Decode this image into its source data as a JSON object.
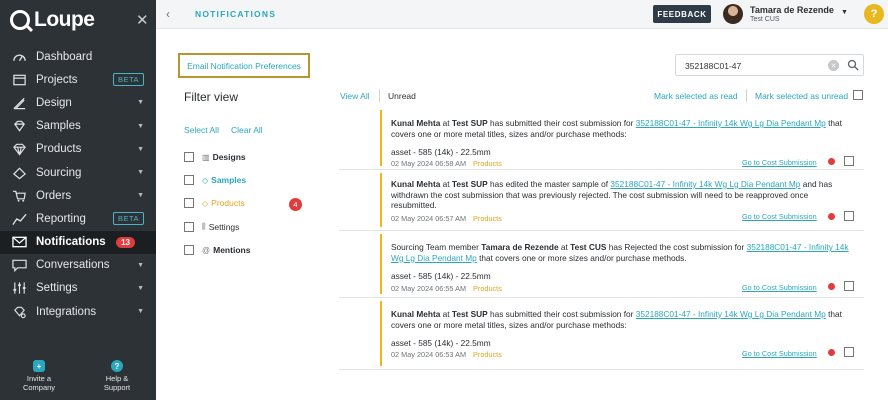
{
  "sidebar": {
    "logo": "Loupe",
    "items": [
      {
        "label": "Dashboard",
        "icon": "dashboard-icon"
      },
      {
        "label": "Projects",
        "icon": "projects-icon",
        "badge": "BETA"
      },
      {
        "label": "Design",
        "icon": "design-icon",
        "caret": "▼"
      },
      {
        "label": "Samples",
        "icon": "samples-icon",
        "caret": "▼"
      },
      {
        "label": "Products",
        "icon": "products-icon",
        "caret": "▼"
      },
      {
        "label": "Sourcing",
        "icon": "sourcing-icon",
        "caret": "▼"
      },
      {
        "label": "Orders",
        "icon": "orders-icon",
        "caret": "▼"
      },
      {
        "label": "Reporting",
        "icon": "reporting-icon",
        "badge": "BETA"
      },
      {
        "label": "Notifications",
        "icon": "mail-icon",
        "count": "13",
        "active": true
      },
      {
        "label": "Conversations",
        "icon": "chat-icon",
        "caret": "▼"
      },
      {
        "label": "Settings",
        "icon": "sliders-icon",
        "caret": "▼"
      },
      {
        "label": "Integrations",
        "icon": "integrations-icon",
        "caret": "▼"
      }
    ],
    "invite_label": "Invite a Company",
    "help_label": "Help & Support"
  },
  "topbar": {
    "breadcrumb": "NOTIFICATIONS",
    "feedback_label": "FEEDBACK",
    "user_name": "Tamara de Rezende",
    "user_org": "Test CUS",
    "help_glyph": "?"
  },
  "main": {
    "email_pref_label": "Email Notification Preferences",
    "search_value": "352188C01-47",
    "filter_title": "Filter view",
    "select_all": "Select All",
    "clear_all": "Clear All",
    "filters": [
      {
        "label": "Designs",
        "color": "#2b2f33",
        "bold": true
      },
      {
        "label": "Samples",
        "color": "#29a8bd",
        "bold": true
      },
      {
        "label": "Products",
        "color": "#e8a21c",
        "bold": false,
        "count": "4"
      },
      {
        "label": "Settings",
        "color": "#2b2f33",
        "bold": false
      },
      {
        "label": "Mentions",
        "color": "#2b2f33",
        "bold": true
      }
    ],
    "tab_view_all": "View All",
    "tab_unread": "Unread",
    "mark_read": "Mark selected as read",
    "mark_unread": "Mark selected as unread"
  },
  "notifications": [
    {
      "actor": "Kunal Mehta",
      "at": "at",
      "org": "Test SUP",
      "text": "has submitted their cost submission for",
      "link": "352188C01-47 - Infinity 14k Wg Lg Dia Pendant Mp",
      "tail": "that covers one or more metal titles, sizes and/or purchase methods:",
      "asset": "asset - 585 (14k) - 22.5mm",
      "date": "02 May 2024 06:58 AM",
      "category": "Products",
      "go": "Go to Cost Submission"
    },
    {
      "actor": "Kunal Mehta",
      "at": "at",
      "org": "Test SUP",
      "text": "has edited the master sample of",
      "link": "352188C01-47 - Infinity 14k Wg Lg Dia Pendant Mp",
      "tail": "and has withdrawn the cost submission that was previously rejected. The cost submission will need to be reapproved once resubmitted.",
      "asset": "",
      "date": "02 May 2024 06:57 AM",
      "category": "Products",
      "go": "Go to Cost Submission"
    },
    {
      "prefix": "Sourcing Team member",
      "actor": "Tamara de Rezende",
      "at": "at",
      "org": "Test CUS",
      "text": "has Rejected the cost submission for",
      "link": "352188C01-47 - Infinity 14k Wg Lg Dia Pendant Mp",
      "tail": "that covers one or more sizes and/or purchase methods.",
      "asset": "asset - 585 (14k) - 22.5mm",
      "date": "02 May 2024 06:55 AM",
      "category": "Products",
      "go": "Go to Cost Submission"
    },
    {
      "actor": "Kunal Mehta",
      "at": "at",
      "org": "Test SUP",
      "text": "has submitted their cost submission for",
      "link": "352188C01-47 - Infinity 14k Wg Lg Dia Pendant Mp",
      "tail": "that covers one or more metal titles, sizes and/or purchase methods:",
      "asset": "asset - 585 (14k) - 22.5mm",
      "date": "02 May 2024 06:53 AM",
      "category": "Products",
      "go": "Go to Cost Submission"
    }
  ],
  "colors": {
    "accent": "#29a8bd",
    "sidebar_bg": "#2d3236",
    "unread_dot": "#e23b3b",
    "product_tag": "#e8a21c",
    "highlight_border": "#b8962f"
  }
}
